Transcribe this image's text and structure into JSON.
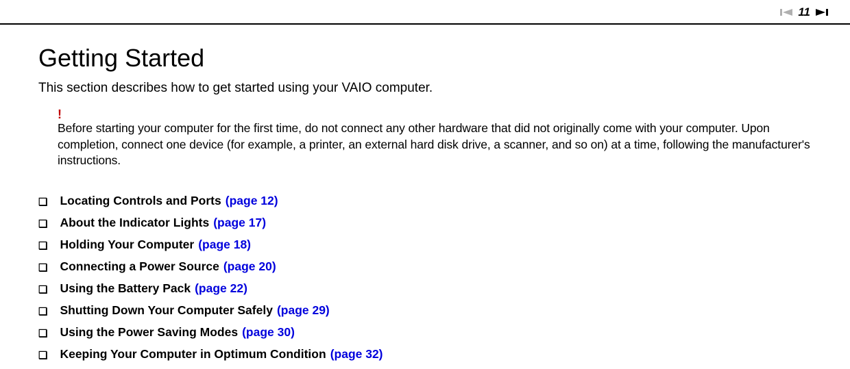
{
  "header": {
    "page_number": "11"
  },
  "title": "Getting Started",
  "intro": "This section describes how to get started using your VAIO computer.",
  "warning": {
    "mark": "!",
    "text": "Before starting your computer for the first time, do not connect any other hardware that did not originally come with your computer. Upon completion, connect one device (for example, a printer, an external hard disk drive, a scanner, and so on) at a time, following the manufacturer's instructions."
  },
  "toc": [
    {
      "label": "Locating Controls and Ports",
      "page": "(page 12)"
    },
    {
      "label": "About the Indicator Lights",
      "page": "(page 17)"
    },
    {
      "label": "Holding Your Computer",
      "page": "(page 18)"
    },
    {
      "label": "Connecting a Power Source",
      "page": "(page 20)"
    },
    {
      "label": "Using the Battery Pack",
      "page": "(page 22)"
    },
    {
      "label": "Shutting Down Your Computer Safely",
      "page": "(page 29)"
    },
    {
      "label": "Using the Power Saving Modes",
      "page": "(page 30)"
    },
    {
      "label": "Keeping Your Computer in Optimum Condition",
      "page": "(page 32)"
    }
  ]
}
